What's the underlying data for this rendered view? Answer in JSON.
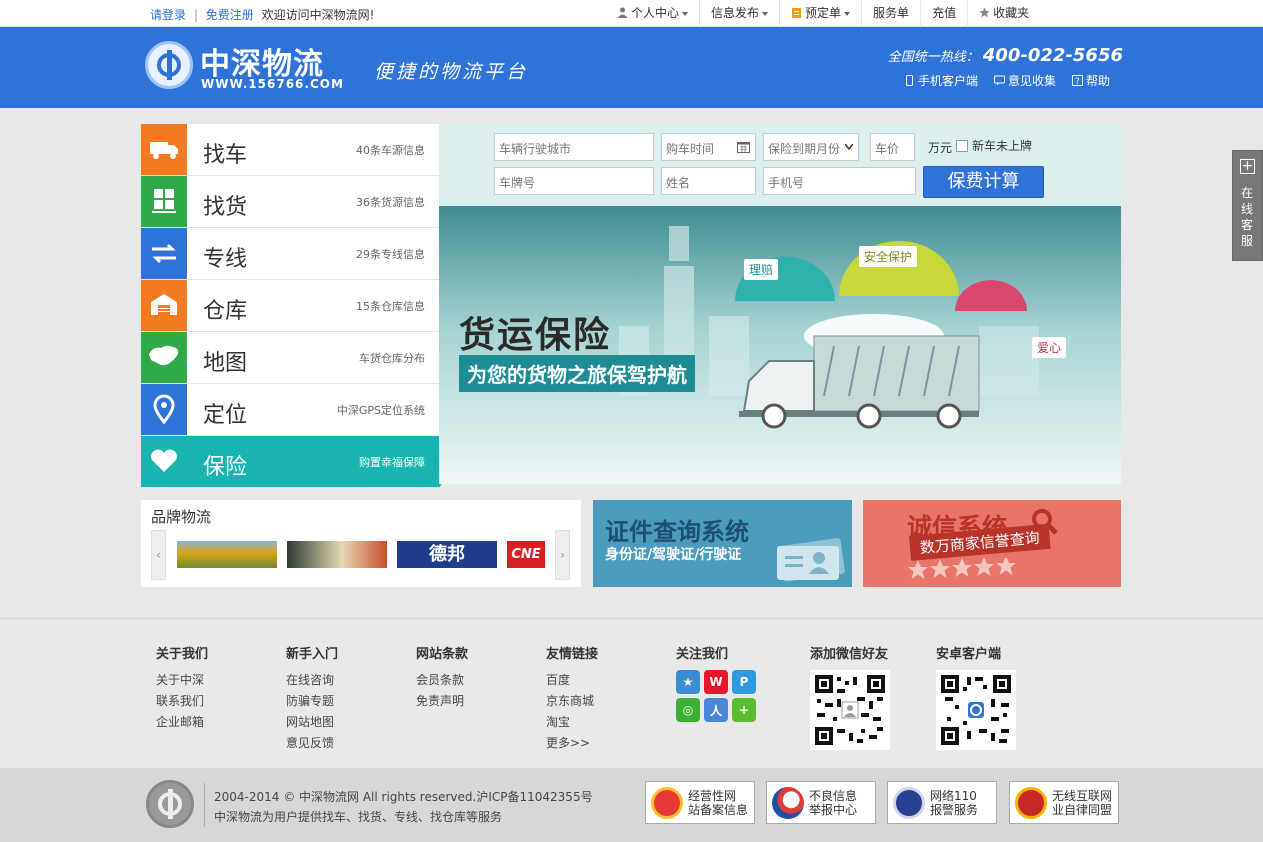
{
  "topbar": {
    "login": "请登录",
    "register": "免费注册",
    "welcome": "欢迎访问中深物流网!",
    "menu": [
      "个人中心",
      "信息发布",
      "预定单",
      "服务单",
      "充值",
      "收藏夹"
    ]
  },
  "header": {
    "logo_title": "中深物流",
    "logo_url": "WWW.156766.COM",
    "slogan": "便捷的物流平台",
    "hotline_label": "全国统一热线：",
    "hotline_number": "400-022-5656",
    "links": [
      "手机客户端",
      "意见收集",
      "帮助"
    ]
  },
  "nav": [
    {
      "name": "找车",
      "info": "40条车源信息",
      "color": "#f47a21",
      "icon": "truck-icon"
    },
    {
      "name": "找货",
      "info": "36条货源信息",
      "color": "#30a94b",
      "icon": "cargo-icon"
    },
    {
      "name": "专线",
      "info": "29条专线信息",
      "color": "#2f73d9",
      "icon": "route-icon"
    },
    {
      "name": "仓库",
      "info": "15条仓库信息",
      "color": "#f47a21",
      "icon": "warehouse-icon"
    },
    {
      "name": "地图",
      "info": "车货仓库分布",
      "color": "#30a94b",
      "icon": "map-icon"
    },
    {
      "name": "定位",
      "info": "中深GPS定位系统",
      "color": "#2f73d9",
      "icon": "location-icon"
    },
    {
      "name": "保险",
      "info": "购置幸福保障",
      "color": "#19b4b0",
      "icon": "heart-icon"
    }
  ],
  "calculator": {
    "city_placeholder": "车辆行驶城市",
    "purchase_time_placeholder": "购车时间",
    "insurance_expiry": "保险到期月份",
    "price_placeholder": "车价",
    "price_unit": "万元",
    "new_car_label": "新车未上牌",
    "plate_placeholder": "车牌号",
    "name_placeholder": "姓名",
    "phone_placeholder": "手机号",
    "button": "保费计算"
  },
  "banner": {
    "title": "货运保险",
    "subtitle": "为您的货物之旅保驾护航",
    "tags": [
      "理赔",
      "安全保护",
      "爱心"
    ]
  },
  "float_service": {
    "label": "在线客服"
  },
  "brand": {
    "title": "品牌物流",
    "prev": "‹",
    "next": "›",
    "logos": [
      "德邦",
      "CNE"
    ]
  },
  "cert": {
    "title": "证件查询系统",
    "subtitle": "身份证/驾驶证/行驶证"
  },
  "credit": {
    "title": "诚信系统",
    "subtitle": "数万商家信誉查询"
  },
  "footer": {
    "columns": [
      {
        "title": "关于我们",
        "links": [
          "关于中深",
          "联系我们",
          "企业邮箱"
        ]
      },
      {
        "title": "新手入门",
        "links": [
          "在线咨询",
          "防骗专题",
          "网站地图",
          "意见反馈"
        ]
      },
      {
        "title": "网站条款",
        "links": [
          "会员条款",
          "免责声明"
        ]
      },
      {
        "title": "友情链接",
        "links": [
          "百度",
          "京东商城",
          "淘宝",
          "更多>>"
        ]
      }
    ],
    "follow_title": "关注我们",
    "wechat_title": "添加微信好友",
    "android_title": "安卓客户端"
  },
  "bottom": {
    "copyright": "2004-2014 © 中深物流网 All rights reserved.沪ICP备11042355号",
    "description": "中深物流为用户提供找车、找货、专线、找仓库等服务",
    "badges": [
      {
        "line1": "经营性网",
        "line2": "站备案信息"
      },
      {
        "line1": "不良信息",
        "line2": "举报中心"
      },
      {
        "line1": "网络110",
        "line2": "报警服务"
      },
      {
        "line1": "无线互联网",
        "line2": "业自律同盟"
      }
    ]
  }
}
